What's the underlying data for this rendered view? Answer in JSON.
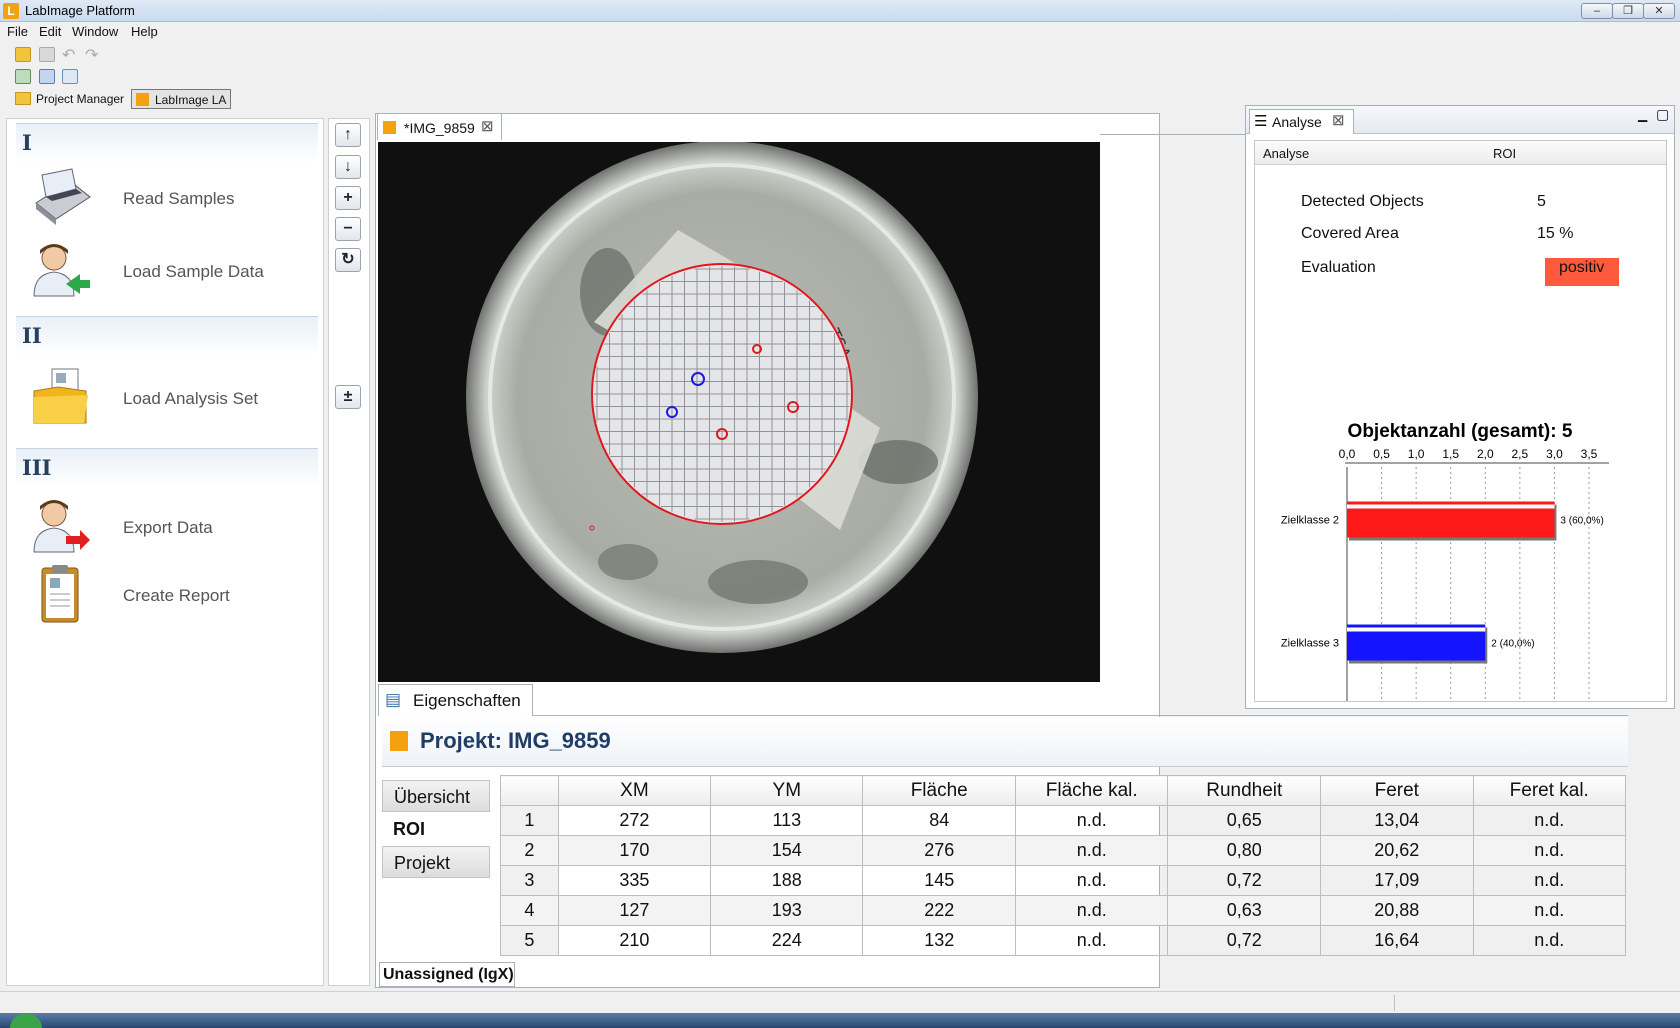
{
  "window": {
    "title": "LabImage Platform",
    "app_icon_letter": "L",
    "controls": [
      "–",
      "❐",
      "✕"
    ]
  },
  "menu": [
    "File",
    "Edit",
    "Window",
    "Help"
  ],
  "perspectives": {
    "project_manager": "Project Manager",
    "labimage_la": "LabImage LA"
  },
  "left_panel": {
    "sections": [
      {
        "numeral": "I",
        "tasks": [
          "Read Samples",
          "Load Sample Data"
        ]
      },
      {
        "numeral": "II",
        "tasks": [
          "Load Analysis Set"
        ]
      },
      {
        "numeral": "III",
        "tasks": [
          "Export Data",
          "Create Report"
        ]
      }
    ]
  },
  "nav_buttons": [
    "↑",
    "↓",
    "+",
    "−",
    "↻",
    "±"
  ],
  "editor": {
    "tab_label": "*IMG_9859",
    "tab_close": "⊠"
  },
  "image": {
    "plate_mark": "TSA"
  },
  "analyse_view": {
    "tab_label": "Analyse",
    "columns": [
      "Analyse",
      "ROI"
    ],
    "rows": [
      {
        "label": "Detected Objects",
        "value": "5"
      },
      {
        "label": "Covered Area",
        "value": "15 %"
      },
      {
        "label": "Evaluation",
        "value": "positiv"
      }
    ],
    "evaluation_color": "#ff5a3c"
  },
  "chart_data": {
    "type": "bar",
    "orientation": "horizontal",
    "title": "Objektanzahl (gesamt): 5",
    "categories": [
      "Zielklasse 2",
      "Zielklasse 3"
    ],
    "values": [
      3,
      2
    ],
    "value_labels": [
      "3 (60,0%)",
      "2 (40,0%)"
    ],
    "colors": [
      "#ff1a1a",
      "#1414ff"
    ],
    "xlim": [
      0,
      3.5
    ],
    "x_ticks": [
      "0,0",
      "0,5",
      "1,0",
      "1,5",
      "2,0",
      "2,5",
      "3,0",
      "3,5"
    ],
    "grid": true
  },
  "properties": {
    "tab_label": "Eigenschaften",
    "project_title": "Projekt: IMG_9859",
    "side_tabs": [
      "Übersicht",
      "ROI",
      "Projekt"
    ],
    "active_side_tab": "ROI",
    "footer_label": "Unassigned (IgX)",
    "columns": [
      "",
      "XM",
      "YM",
      "Fläche",
      "Fläche kal.",
      "Rundheit",
      "Feret",
      "Feret kal."
    ],
    "rows": [
      [
        "1",
        "272",
        "113",
        "84",
        "n.d.",
        "0,65",
        "13,04",
        "n.d."
      ],
      [
        "2",
        "170",
        "154",
        "276",
        "n.d.",
        "0,80",
        "20,62",
        "n.d."
      ],
      [
        "3",
        "335",
        "188",
        "145",
        "n.d.",
        "0,72",
        "17,09",
        "n.d."
      ],
      [
        "4",
        "127",
        "193",
        "222",
        "n.d.",
        "0,63",
        "20,88",
        "n.d."
      ],
      [
        "5",
        "210",
        "224",
        "132",
        "n.d.",
        "0,72",
        "16,64",
        "n.d."
      ]
    ]
  }
}
